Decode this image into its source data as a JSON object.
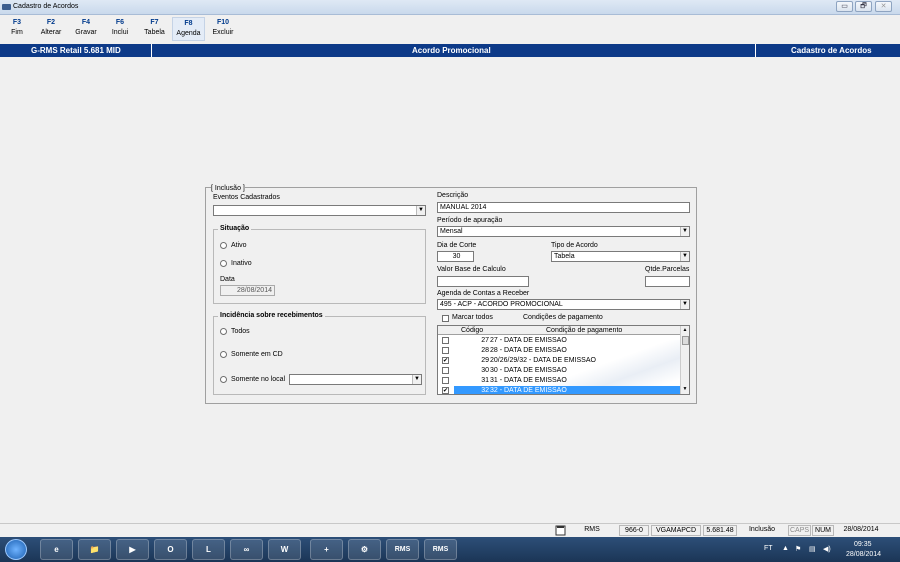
{
  "window": {
    "title": "Cadastro de Acordos"
  },
  "window_buttons": [
    "▭",
    "🗗",
    "✕"
  ],
  "fkeys": [
    {
      "key": "F3",
      "label": "Fim"
    },
    {
      "key": "F2",
      "label": "Alterar"
    },
    {
      "key": "F4",
      "label": "Gravar"
    },
    {
      "key": "F6",
      "label": "Inclui"
    },
    {
      "key": "F7",
      "label": "Tabela"
    },
    {
      "key": "F8",
      "label": "Agenda"
    },
    {
      "key": "F10",
      "label": "Excluir"
    }
  ],
  "header": {
    "app": "G-RMS Retail 5.681 MID",
    "screen": "Acordo Promocional",
    "module": "Cadastro de Acordos"
  },
  "form": {
    "mode": "[ Inclusão ]",
    "eventos_label": "Eventos Cadastrados",
    "eventos_value": "",
    "situacao": {
      "title": "Situação",
      "ativo": "Ativo",
      "inativo": "Inativo",
      "data_label": "Data",
      "data_value": "28/08/2014"
    },
    "incidencia": {
      "title": "Incidência sobre recebimentos",
      "todos": "Todos",
      "somente_cd": "Somente em CD",
      "somente_local": "Somente no local",
      "local_value": ""
    },
    "descricao_label": "Descrição",
    "descricao_value": "MANUAL 2014",
    "periodo_label": "Período de apuração",
    "periodo_value": "Mensal",
    "dia_corte_label": "Dia de Corte",
    "dia_corte_value": "30",
    "tipo_acordo_label": "Tipo de Acordo",
    "tipo_acordo_value": "Tabela",
    "valor_base_label": "Valor Base de Calculo",
    "valor_base_value": "",
    "qtde_parcelas_label": "Qtde.Parcelas",
    "qtde_parcelas_value": "",
    "agenda_label": "Agenda de Contas a Receber",
    "agenda_value": "495 - ACP - ACORDO PROMOCIONAL",
    "marcar_todos": "Marcar todos",
    "condicoes_label": "Condições de pagamento",
    "grid": {
      "col_codigo": "Código",
      "col_condicao": "Condição de pagamento",
      "rows": [
        {
          "checked": false,
          "codigo": "27",
          "descricao": "27 - DATA DE EMISSAO",
          "selected": false
        },
        {
          "checked": false,
          "codigo": "28",
          "descricao": "28 - DATA DE EMISSAO",
          "selected": false
        },
        {
          "checked": true,
          "codigo": "29",
          "descricao": "20/26/29/32 - DATA DE EMISSAO",
          "selected": false
        },
        {
          "checked": false,
          "codigo": "30",
          "descricao": "30 - DATA DE EMISSAO",
          "selected": false
        },
        {
          "checked": false,
          "codigo": "31",
          "descricao": "31 - DATA DE EMISSAO",
          "selected": false
        },
        {
          "checked": true,
          "codigo": "32",
          "descricao": "32 - DATA DE EMISSAO",
          "selected": true
        }
      ]
    }
  },
  "statusbar": {
    "system": "RMS",
    "code": "966-0",
    "user": "VGAMAPCD",
    "version": "5.681.48",
    "mode": "Inclusão",
    "caps": "CAPS",
    "num": "NUM",
    "date": "28/08/2014"
  },
  "taskbar": {
    "apps": [
      "e",
      "📁",
      "▶",
      "O",
      "L",
      "∞",
      "W",
      "+",
      "⚙",
      "RMS",
      "RMS"
    ],
    "tray_lang": "FT",
    "clock_time": "09:35",
    "clock_date": "28/08/2014"
  },
  "colors": {
    "header_blue": "#0d3a88",
    "select_blue": "#3399ff",
    "fkey_blue": "#003a8c"
  }
}
